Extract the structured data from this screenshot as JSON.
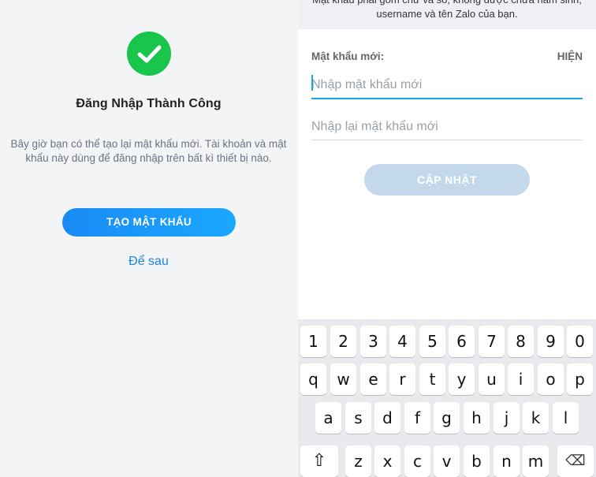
{
  "left": {
    "title": "Đăng Nhập Thành Công",
    "description": "Bây giờ bạn có thể tạo lại mật khẩu mới. Tài khoản và mật khẩu này dùng để đăng nhập trên bất kì thiết bị nào.",
    "create_button": "TẠO MẬT KHẨU",
    "later_link": "Để sau",
    "success_color": "#18c64c"
  },
  "right": {
    "hint": "Mật khẩu phải gồm chữ và số, không được chứa năm sinh, username và tên Zalo của bạn.",
    "new_label": "Mật khẩu mới:",
    "show_toggle": "HIỆN",
    "new_placeholder": "Nhập mật khẩu mới",
    "confirm_placeholder": "Nhập lại mật khẩu mới",
    "update_button": "CẬP NHẬT",
    "accent_color": "#1aa3ef"
  },
  "keyboard": {
    "row1": [
      "1",
      "2",
      "3",
      "4",
      "5",
      "6",
      "7",
      "8",
      "9",
      "0"
    ],
    "row2": [
      "q",
      "w",
      "e",
      "r",
      "t",
      "y",
      "u",
      "i",
      "o",
      "p"
    ],
    "row3": [
      "a",
      "s",
      "d",
      "f",
      "g",
      "h",
      "j",
      "k",
      "l"
    ],
    "row4": [
      "z",
      "x",
      "c",
      "v",
      "b",
      "n",
      "m"
    ],
    "shift_icon": "⇧",
    "backspace_icon": "⌫"
  }
}
